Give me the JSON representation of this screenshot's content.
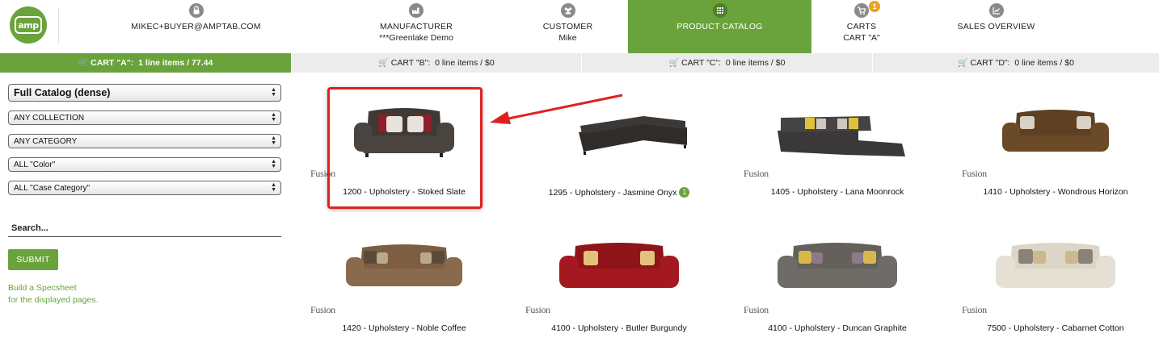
{
  "brand": {
    "logo_text": "amp",
    "color": "#6aa33b"
  },
  "nav": {
    "user_email": "MIKEC+BUYER@AMPTAB.COM",
    "manufacturer": {
      "label": "MANUFACTURER",
      "value": "***Greenlake Demo"
    },
    "customer": {
      "label": "CUSTOMER",
      "value": "Mike"
    },
    "catalog": {
      "label": "PRODUCT CATALOG"
    },
    "carts": {
      "label": "CARTS",
      "value": "CART \"A\"",
      "badge": "1"
    },
    "sales": {
      "label": "SALES OVERVIEW"
    }
  },
  "carts": [
    {
      "label": "CART \"A\":",
      "detail": "1 line items / 77.44",
      "active": true
    },
    {
      "label": "CART \"B\":",
      "detail": "0 line items / $0",
      "active": false
    },
    {
      "label": "CART \"C\":",
      "detail": "0 line items / $0",
      "active": false
    },
    {
      "label": "CART \"D\":",
      "detail": "0 line items / $0",
      "active": false
    }
  ],
  "filters": {
    "view": "Full Catalog (dense)",
    "collection": "ANY COLLECTION",
    "category": "ANY CATEGORY",
    "color": "ALL \"Color\"",
    "case_category": "ALL \"Case Category\"",
    "search_placeholder": "Search...",
    "submit_label": "SUBMIT",
    "specsheet_line1": "Build a Specsheet",
    "specsheet_line2": "for the displayed pages."
  },
  "products": [
    {
      "name": "1200 - Upholstery - Stoked Slate",
      "brand": "Fusion",
      "badge": ""
    },
    {
      "name": "1295 - Upholstery - Jasmine Onyx",
      "brand": "",
      "badge": "1"
    },
    {
      "name": "1405 - Upholstery - Lana Moonrock",
      "brand": "Fusion",
      "badge": ""
    },
    {
      "name": "1410 - Upholstery - Wondrous Horizon",
      "brand": "Fusion",
      "badge": ""
    },
    {
      "name": "1420 - Upholstery - Noble Coffee",
      "brand": "Fusion",
      "badge": ""
    },
    {
      "name": "4100 - Upholstery - Butler Burgundy",
      "brand": "Fusion",
      "badge": ""
    },
    {
      "name": "4100 - Upholstery - Duncan Graphite",
      "brand": "Fusion",
      "badge": ""
    },
    {
      "name": "7500 - Upholstery - Cabarnet Cotton",
      "brand": "Fusion",
      "badge": ""
    }
  ],
  "colors": {
    "accent": "#6aa33b",
    "badge": "#f0a21b",
    "highlight": "#e02020"
  }
}
